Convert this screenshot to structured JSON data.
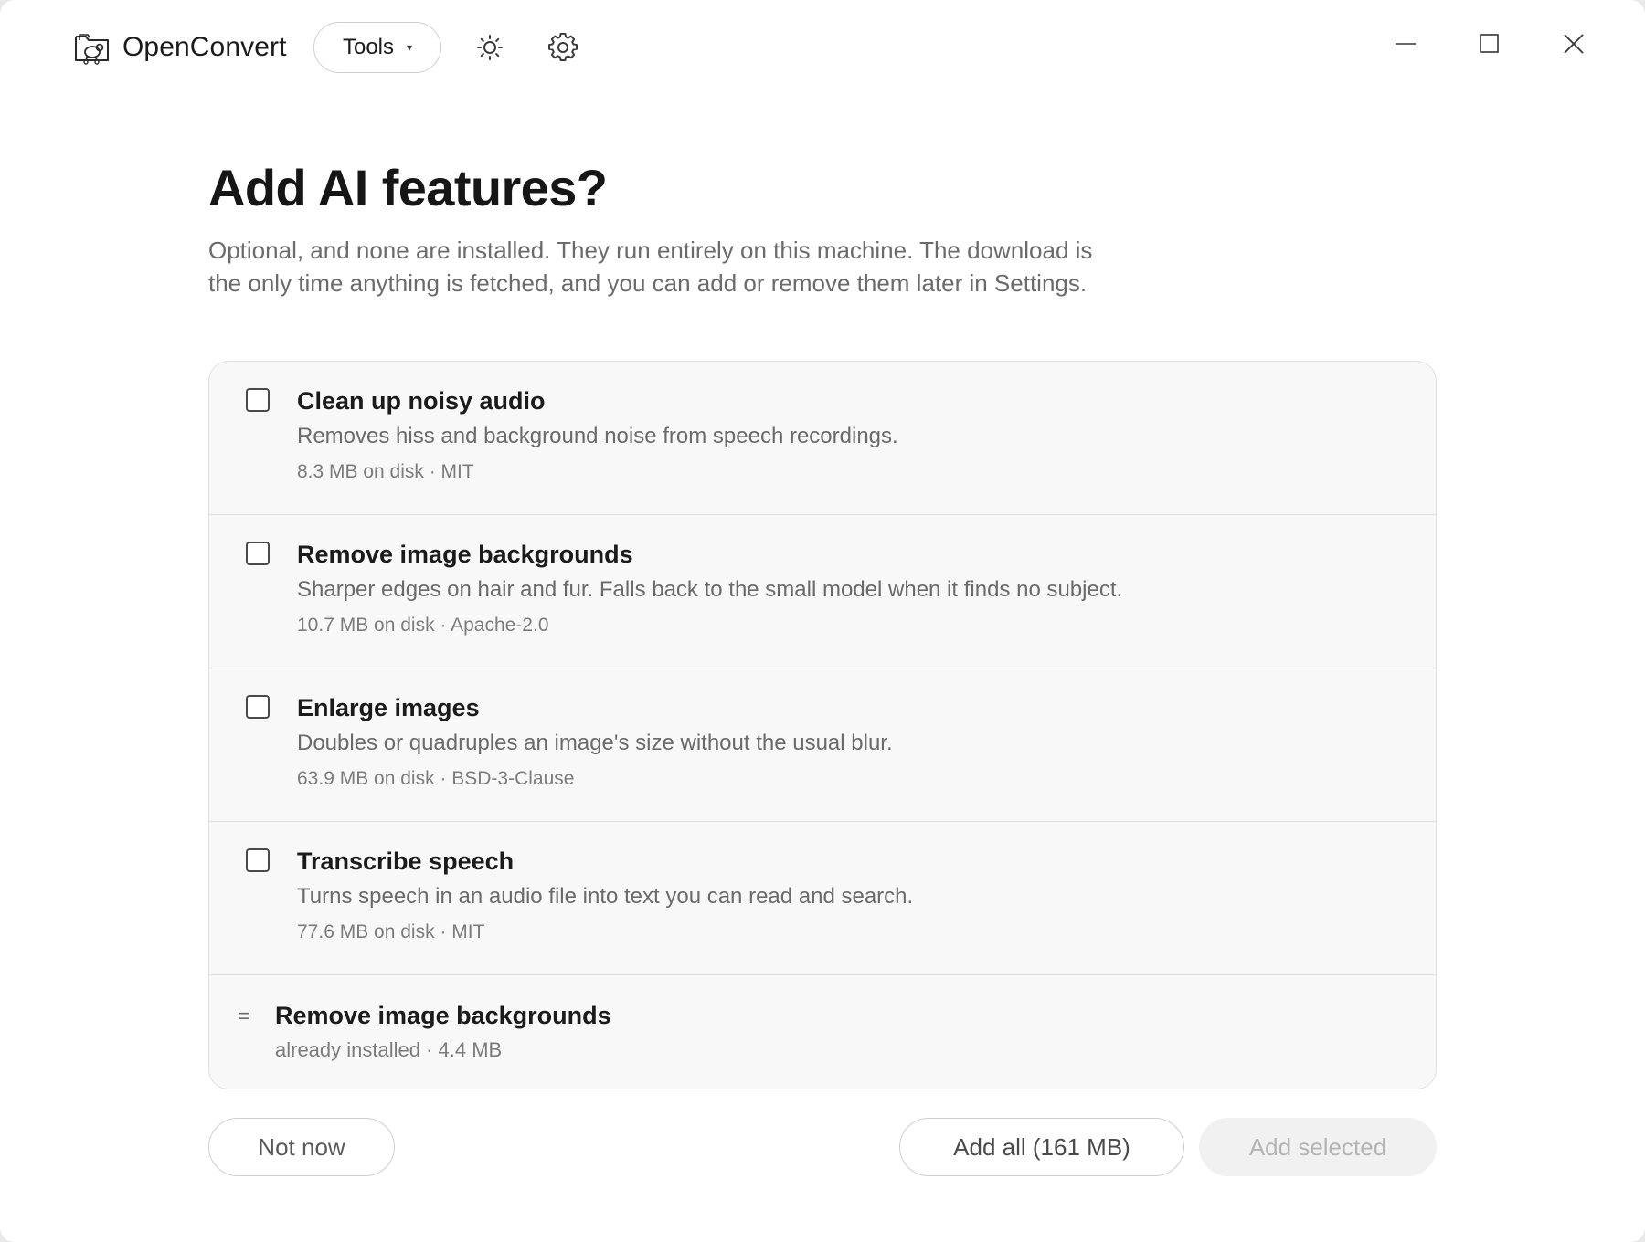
{
  "app": {
    "name": "OpenConvert"
  },
  "toolbar": {
    "tools_label": "Tools",
    "tools_caret": "▾",
    "theme_icon": "sun-icon",
    "settings_icon": "gear-icon"
  },
  "window_controls": {
    "minimize_icon": "minimize-icon",
    "maximize_icon": "maximize-icon",
    "close_icon": "close-icon"
  },
  "page": {
    "title": "Add AI features?",
    "description": "Optional, and none are installed. They run entirely on this machine. The download is the only time anything is fetched, and you can add or remove them later in Settings."
  },
  "features": [
    {
      "title": "Clean up noisy audio",
      "description": "Removes hiss and background noise from speech recordings.",
      "meta": "8.3 MB on disk · MIT",
      "checked": false
    },
    {
      "title": "Remove image backgrounds",
      "description": "Sharper edges on hair and fur. Falls back to the small model when it finds no subject.",
      "meta": "10.7 MB on disk · Apache-2.0",
      "checked": false
    },
    {
      "title": "Enlarge images",
      "description": "Doubles or quadruples an image's size without the usual blur.",
      "meta": "63.9 MB on disk · BSD-3-Clause",
      "checked": false
    },
    {
      "title": "Transcribe speech",
      "description": "Turns speech in an audio file into text you can read and search.",
      "meta": "77.6 MB on disk · MIT",
      "checked": false
    }
  ],
  "installed": {
    "marker": "=",
    "title": "Remove image backgrounds",
    "meta": "already installed · 4.4 MB"
  },
  "footer": {
    "not_now_label": "Not now",
    "add_all_label": "Add all (161 MB)",
    "add_selected_label": "Add selected",
    "add_selected_disabled": true
  }
}
